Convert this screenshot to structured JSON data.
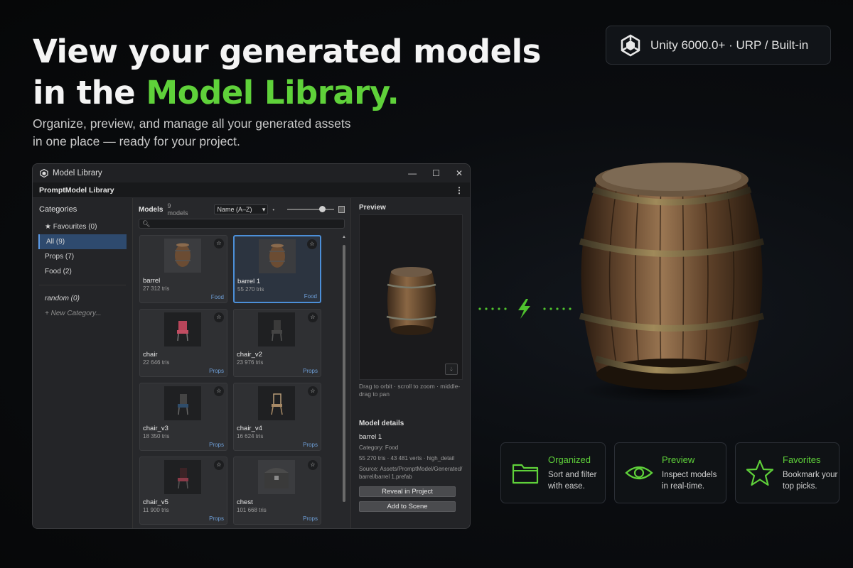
{
  "hero": {
    "title_line1": "View your generated models",
    "title_line2_prefix": "in the ",
    "title_line2_accent": "Model Library.",
    "subtitle_line1": "Organize, preview, and manage all your generated assets",
    "subtitle_line2": "in one place — ready for your project."
  },
  "badge": {
    "text": "Unity 6000.0+ · URP / Built-in",
    "icon": "unity-logo-icon"
  },
  "colors": {
    "accent": "#5fd13a",
    "selection": "#4c8fd8",
    "category_link": "#6e9fd8"
  },
  "window": {
    "title": "Model Library",
    "subtitle": "PromptModel Library",
    "controls": [
      "minimize",
      "maximize",
      "close"
    ]
  },
  "sidebar": {
    "heading": "Categories",
    "items": [
      {
        "label": "★ Favourites  (0)"
      },
      {
        "label": "All  (9)"
      },
      {
        "label": "Props  (7)"
      },
      {
        "label": "Food  (2)"
      }
    ],
    "custom": [
      {
        "label": "random  (0)"
      }
    ],
    "new_label": "+ New Category..."
  },
  "models": {
    "title": "Models",
    "count": "9 models",
    "sort": "Name (A–Z)",
    "search_placeholder": "",
    "thumbnail_size": 0.8,
    "cards": [
      {
        "name": "barrel",
        "tris": "27 312 tris",
        "category": "Food"
      },
      {
        "name": "barrel 1",
        "tris": "55 270 tris",
        "category": "Food"
      },
      {
        "name": "chair",
        "tris": "22 646 tris",
        "category": "Props"
      },
      {
        "name": "chair_v2",
        "tris": "23 976 tris",
        "category": "Props"
      },
      {
        "name": "chair_v3",
        "tris": "18 350 tris",
        "category": "Props"
      },
      {
        "name": "chair_v4",
        "tris": "16 624 tris",
        "category": "Props"
      },
      {
        "name": "chair_v5",
        "tris": "11 900 tris",
        "category": "Props"
      },
      {
        "name": "chest",
        "tris": "101 668 tris",
        "category": "Props"
      }
    ]
  },
  "preview": {
    "heading": "Preview",
    "hint": "Drag to orbit · scroll to zoom · middle-drag to pan"
  },
  "details": {
    "heading": "Model details",
    "name": "barrel 1",
    "category": "Category: Food",
    "stats": "55 270 tris · 43 481 verts · high_detail",
    "source": "Source: Assets/PromptModel/Generated/barrel/barrel 1.prefab",
    "reveal_label": "Reveal in Project",
    "add_label": "Add to Scene"
  },
  "features": [
    {
      "title": "Organized",
      "line1": "Sort and filter",
      "line2": "with ease.",
      "icon": "folder-icon"
    },
    {
      "title": "Preview",
      "line1": "Inspect models",
      "line2": "in real-time.",
      "icon": "eye-icon"
    },
    {
      "title": "Favorites",
      "line1": "Bookmark your",
      "line2": "top picks.",
      "icon": "star-icon"
    }
  ]
}
